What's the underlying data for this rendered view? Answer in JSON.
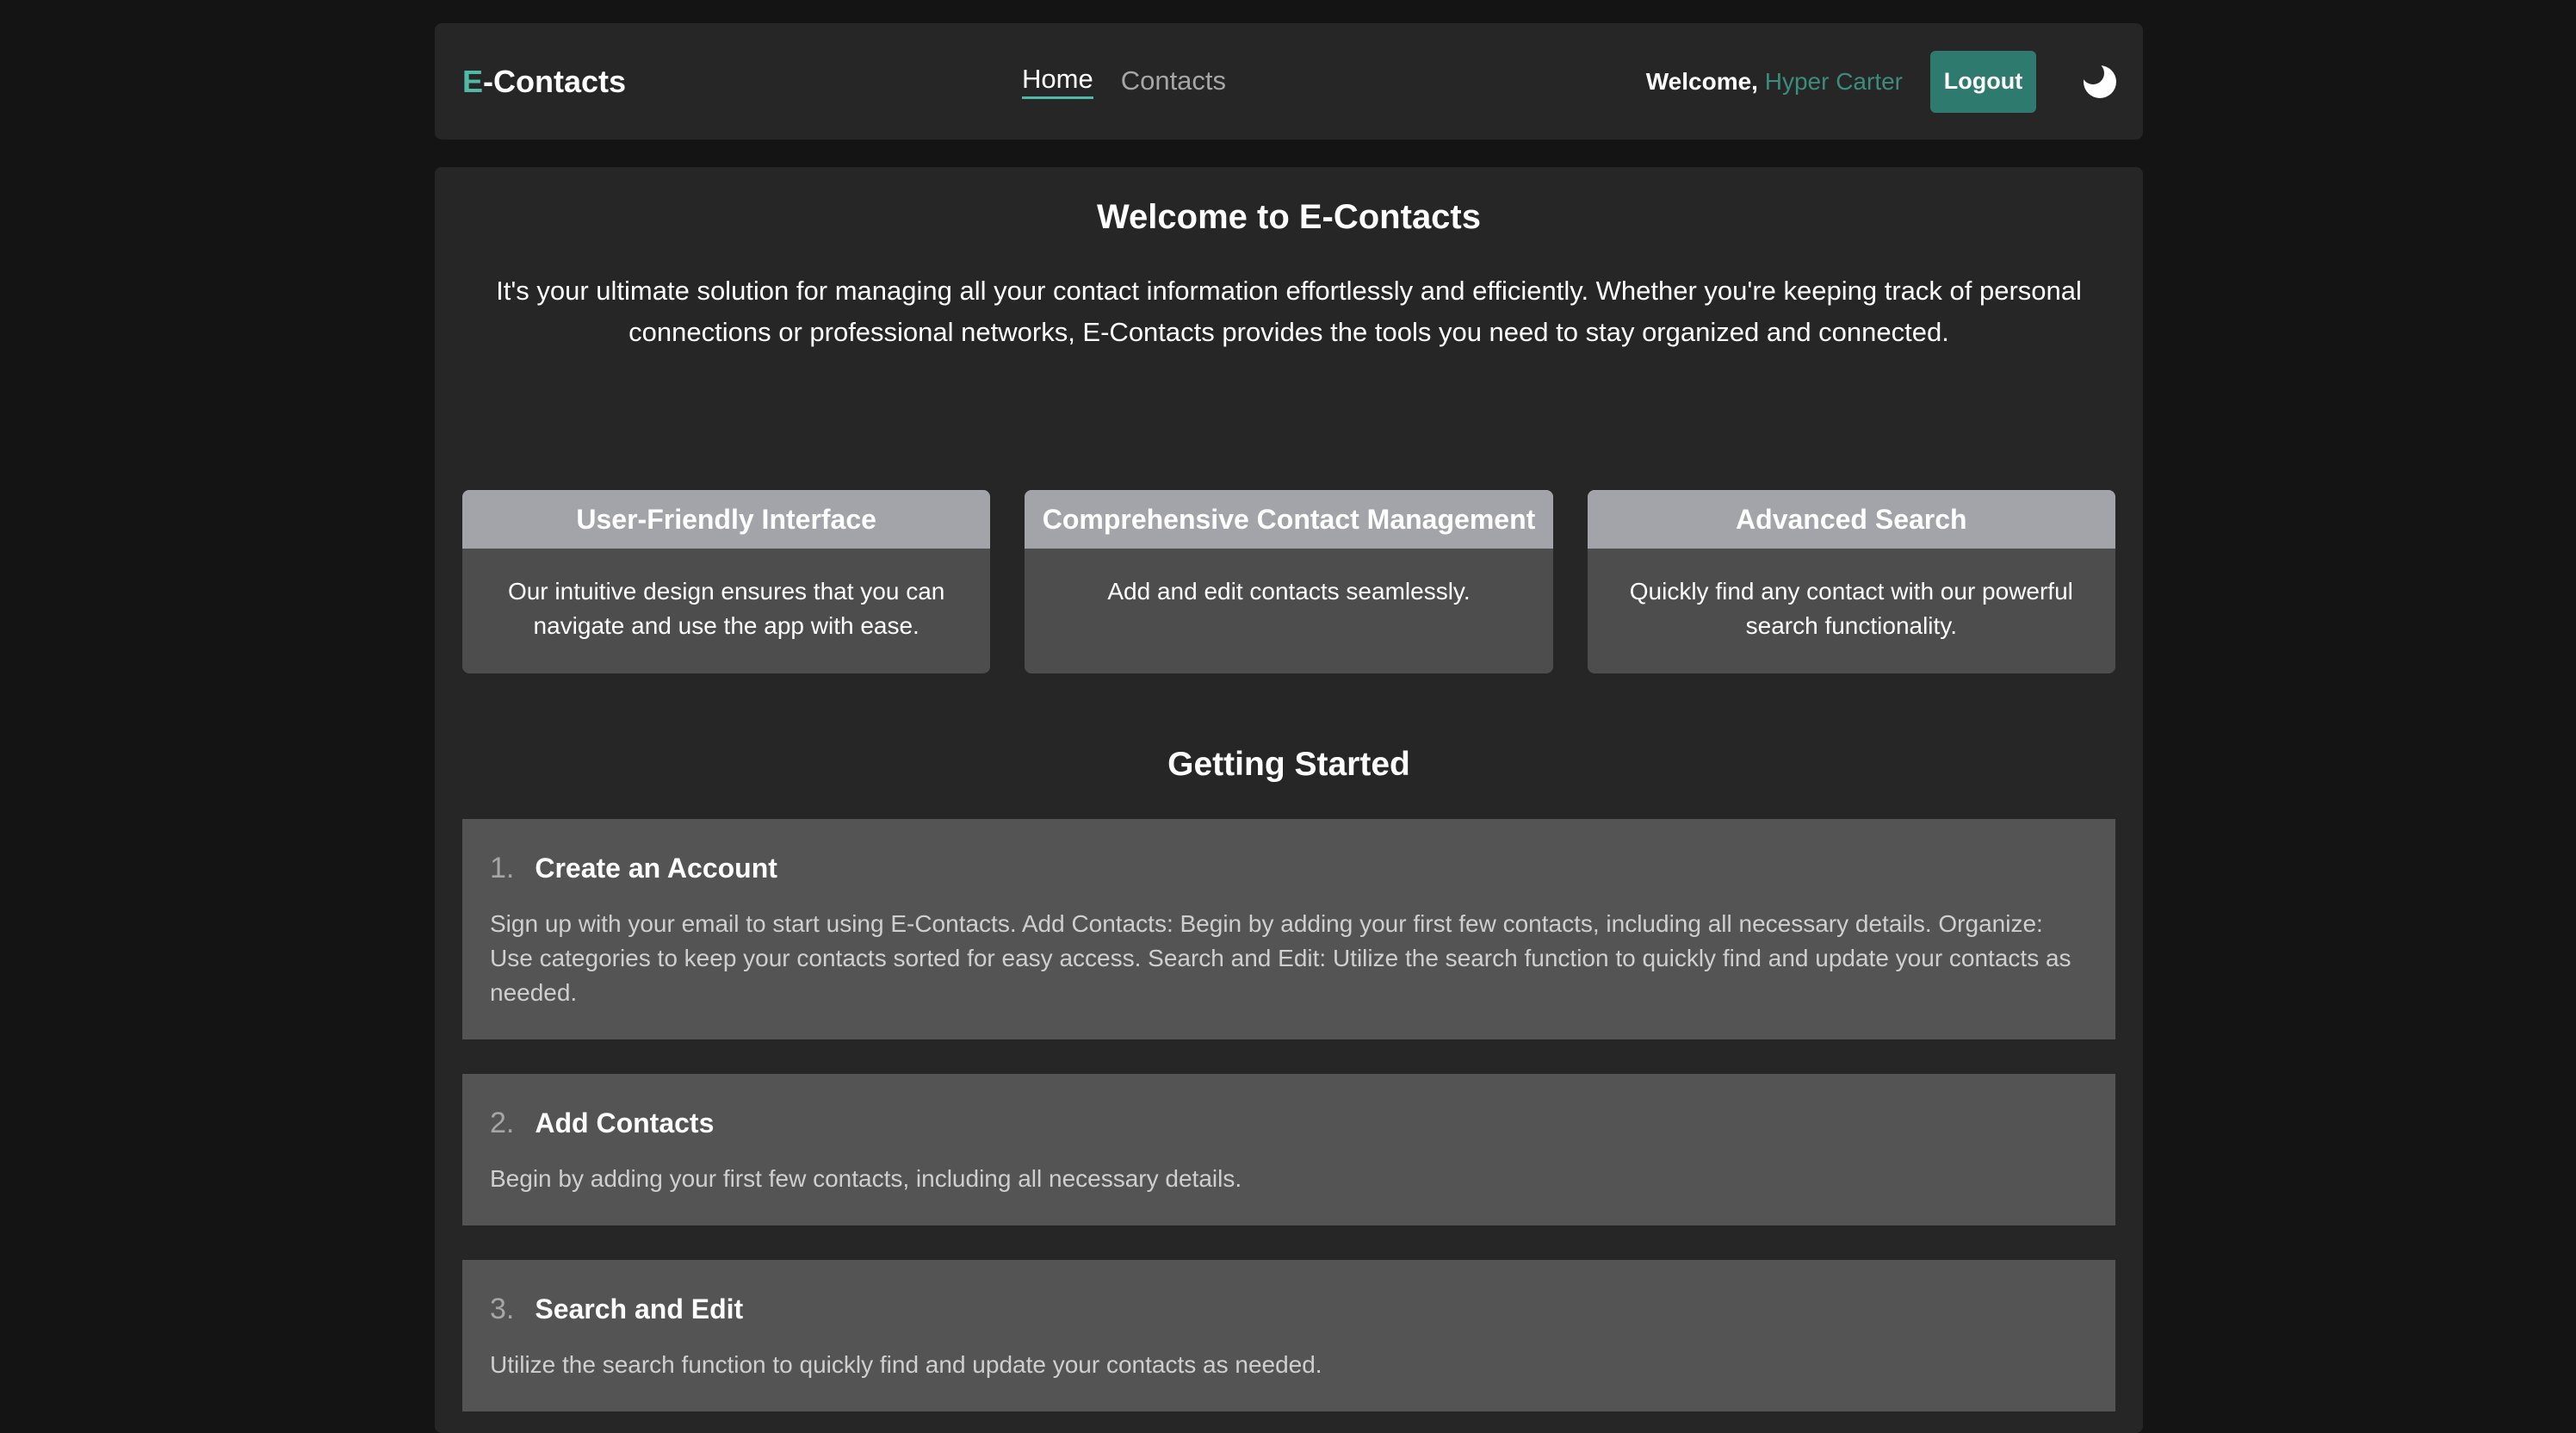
{
  "nav": {
    "brand_accent": "E",
    "brand_rest": "-Contacts",
    "links": [
      {
        "label": "Home",
        "active": true
      },
      {
        "label": "Contacts",
        "active": false
      }
    ],
    "welcome_label": "Welcome,",
    "username": "Hyper Carter",
    "logout_label": "Logout",
    "theme_icon": "moon-icon"
  },
  "hero": {
    "title": "Welcome to E-Contacts",
    "intro": "It's your ultimate solution for managing all your contact information effortlessly and efficiently. Whether you're keeping track of personal connections or professional networks, E-Contacts provides the tools you need to stay organized and connected."
  },
  "features": [
    {
      "title": "User-Friendly Interface",
      "description": "Our intuitive design ensures that you can navigate and use the app with ease."
    },
    {
      "title": "Comprehensive Contact Management",
      "description": "Add and edit contacts seamlessly."
    },
    {
      "title": "Advanced Search",
      "description": "Quickly find any contact with our powerful search functionality."
    }
  ],
  "getting_started": {
    "title": "Getting Started",
    "steps": [
      {
        "number": "1.",
        "title": "Create an Account",
        "text": "Sign up with your email to start using E-Contacts. Add Contacts: Begin by adding your first few contacts, including all necessary details. Organize: Use categories to keep your contacts sorted for easy access. Search and Edit: Utilize the search function to quickly find and update your contacts as needed."
      },
      {
        "number": "2.",
        "title": "Add Contacts",
        "text": "Begin by adding your first few contacts, including all necessary details."
      },
      {
        "number": "3.",
        "title": "Search and Edit",
        "text": "Utilize the search function to quickly find and update your contacts as needed."
      }
    ]
  },
  "colors": {
    "page_bg": "#141414",
    "panel_bg": "#262626",
    "accent": "#4fb8a6",
    "username": "#3c8c7e",
    "logout_bg": "#2e7a6e",
    "card_header": "#a3a3aa",
    "card_bg": "#4d4d4d",
    "step_bg": "#545454"
  }
}
